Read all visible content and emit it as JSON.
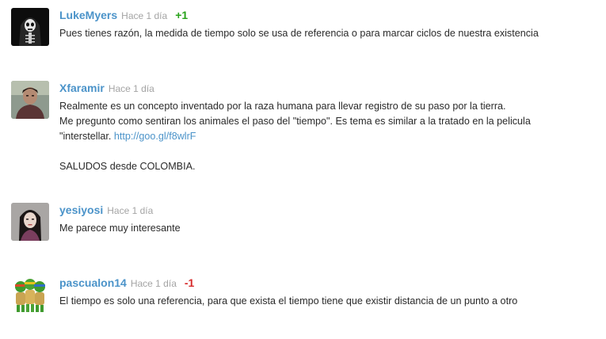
{
  "comments": [
    {
      "username": "LukeMyers",
      "time": "Hace 1 día",
      "vote": "+1",
      "lines": [
        "Pues tienes razón, la medida de tiempo solo se usa de referencia o para marcar ciclos de nuestra existencia"
      ]
    },
    {
      "username": "Xfaramir",
      "time": "Hace 1 día",
      "lines": [
        "Realmente es un concepto inventado por la raza humana para llevar registro de su paso por la tierra.",
        "Me pregunto como sentiran los animales el paso del \"tiempo\". Es tema es similar a la tratado en la pelicula",
        "\"interstellar. ",
        "",
        "SALUDOS desde COLOMBIA."
      ],
      "link": "http://goo.gl/f8wlrF"
    },
    {
      "username": "yesiyosi",
      "time": "Hace 1 día",
      "lines": [
        "Me parece muy interesante"
      ]
    },
    {
      "username": "pascualon14",
      "time": "Hace 1 día",
      "vote": "-1",
      "lines": [
        "El tiempo es solo una referencia, para que exista el tiempo tiene que existir distancia de un punto a otro"
      ]
    }
  ],
  "colors": {
    "username": "#4b93c9",
    "time": "#a4a4a4",
    "text": "#2a2a2a",
    "vote_positive": "#27a219",
    "vote_negative": "#d62b2b"
  },
  "icons": {
    "avatar_1": "skeleton-hoodie-avatar",
    "avatar_2": "man-portrait-avatar",
    "avatar_3": "woman-portrait-avatar",
    "avatar_4": "ninja-turtles-avatar"
  }
}
